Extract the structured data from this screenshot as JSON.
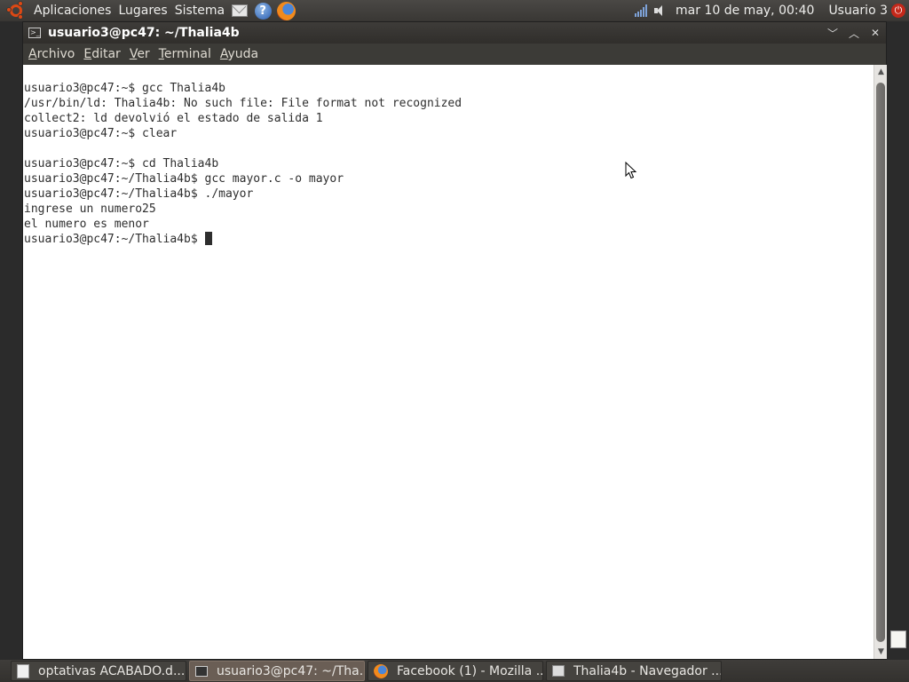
{
  "top_panel": {
    "menus": [
      "Aplicaciones",
      "Lugares",
      "Sistema"
    ],
    "clock": "mar 10 de may, 00:40",
    "user": "Usuario 3"
  },
  "window": {
    "title": "usuario3@pc47: ~/Thalia4b",
    "menu": [
      {
        "accel": "A",
        "rest": "rchivo"
      },
      {
        "accel": "E",
        "rest": "ditar"
      },
      {
        "accel": "V",
        "rest": "er"
      },
      {
        "accel": "T",
        "rest": "erminal"
      },
      {
        "accel": "A",
        "rest": "yuda"
      }
    ]
  },
  "terminal": {
    "lines": [
      "usuario3@pc47:~$ gcc Thalia4b",
      "/usr/bin/ld: Thalia4b: No such file: File format not recognized",
      "collect2: ld devolvió el estado de salida 1",
      "usuario3@pc47:~$ clear",
      "",
      "usuario3@pc47:~$ cd Thalia4b",
      "usuario3@pc47:~/Thalia4b$ gcc mayor.c -o mayor",
      "usuario3@pc47:~/Thalia4b$ ./mayor",
      "ingrese un numero25",
      "el numero es menor"
    ],
    "prompt": "usuario3@pc47:~/Thalia4b$ "
  },
  "taskbar": {
    "tasks": [
      {
        "label": "optativas ACABADO.d...",
        "icon": "document-icon",
        "active": false
      },
      {
        "label": "usuario3@pc47: ~/Tha...",
        "icon": "terminal-icon",
        "active": true
      },
      {
        "label": "Facebook (1) - Mozilla ...",
        "icon": "firefox-icon",
        "active": false
      },
      {
        "label": "Thalia4b - Navegador ...",
        "icon": "folder-icon",
        "active": false
      }
    ]
  }
}
